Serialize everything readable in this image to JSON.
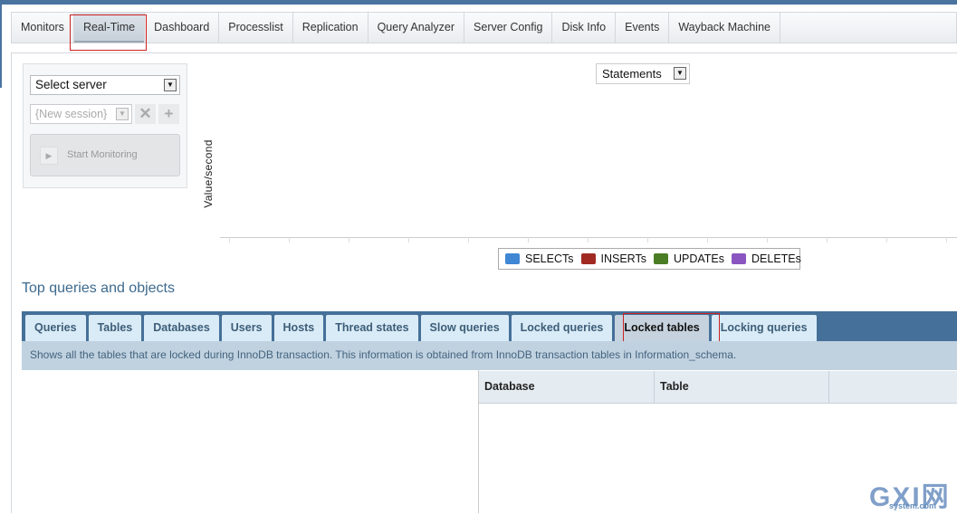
{
  "nav": {
    "tabs": [
      "Monitors",
      "Real-Time",
      "Dashboard",
      "Processlist",
      "Replication",
      "Query Analyzer",
      "Server Config",
      "Disk Info",
      "Events",
      "Wayback Machine"
    ],
    "active": "Real-Time"
  },
  "control": {
    "server_select": "Select server",
    "session_select": "{New session}",
    "delete_icon": "x-icon",
    "add_icon": "plus-icon",
    "start_label": "Start Monitoring"
  },
  "chart": {
    "metric_select": "Statements",
    "ylabel": "Value/second",
    "legend": [
      {
        "label": "SELECTs",
        "color": "#3f86d4"
      },
      {
        "label": "INSERTs",
        "color": "#a02a22"
      },
      {
        "label": "UPDATEs",
        "color": "#4a7d24"
      },
      {
        "label": "DELETEs",
        "color": "#8a55c0"
      }
    ]
  },
  "section": {
    "title": "Top queries and objects",
    "tabs": [
      "Queries",
      "Tables",
      "Databases",
      "Users",
      "Hosts",
      "Thread states",
      "Slow queries",
      "Locked queries",
      "Locked tables",
      "Locking queries"
    ],
    "active": "Locked tables",
    "description": "Shows all the tables that are locked during InnoDB transaction. This information is obtained from InnoDB transaction tables in Information_schema.",
    "columns": [
      "Database",
      "Table",
      ""
    ]
  },
  "watermark": "GXI网 system.com"
}
